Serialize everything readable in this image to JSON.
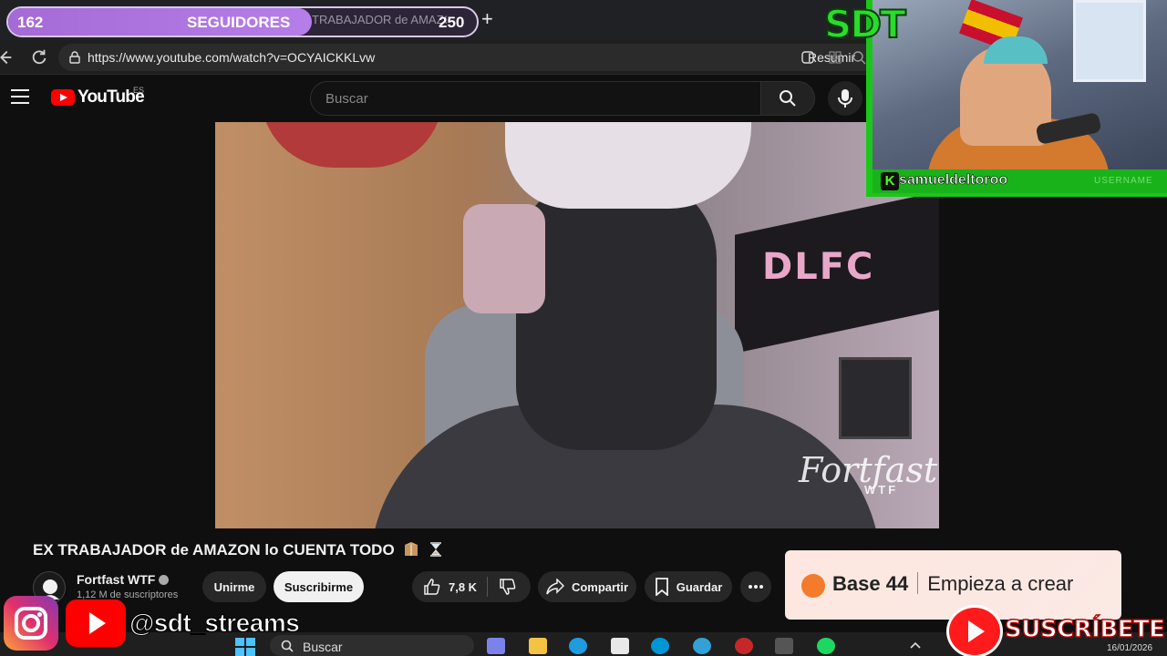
{
  "browser": {
    "tab_title": "X TRABAJADOR de AMAZO",
    "url": "https://www.youtube.com/watch?v=OCYAICKKLvw",
    "resumir_label": "Resumir"
  },
  "youtube": {
    "logo_text": "YouTube",
    "country_code": "ES",
    "search_placeholder": "Buscar"
  },
  "video": {
    "watermark": "Fortfast",
    "watermark_sub": "WTF",
    "poster_text": "DLFC",
    "title": "EX TRABAJADOR de AMAZON lo CUENTA TODO",
    "channel_name": "Fortfast WTF",
    "subscribers": "1,12 M de suscriptores",
    "join_label": "Unirme",
    "subscribe_label": "Suscribirme",
    "likes": "7,8 K",
    "share_label": "Compartir",
    "save_label": "Guardar"
  },
  "ad": {
    "brand": "Base 44",
    "tagline": "Empieza a crear"
  },
  "taskbar": {
    "search_label": "Buscar",
    "date": "16/01/2026"
  },
  "overlay": {
    "followers_current": "162",
    "followers_label": "SEGUIDORES",
    "followers_goal": "250",
    "followers_progress": 0.648,
    "sdt_logo": "SDT",
    "kick_badge": "K",
    "cam_username": "samueldeltoroo",
    "cam_user_label": "USERNAME",
    "social_handle": "@sdt_streams",
    "subscribe_cta": "SUSCRÍBETE"
  },
  "colors": {
    "youtube_red": "#ff0000",
    "overlay_green": "#1bc61b",
    "follow_purple": "#a56ad6"
  }
}
